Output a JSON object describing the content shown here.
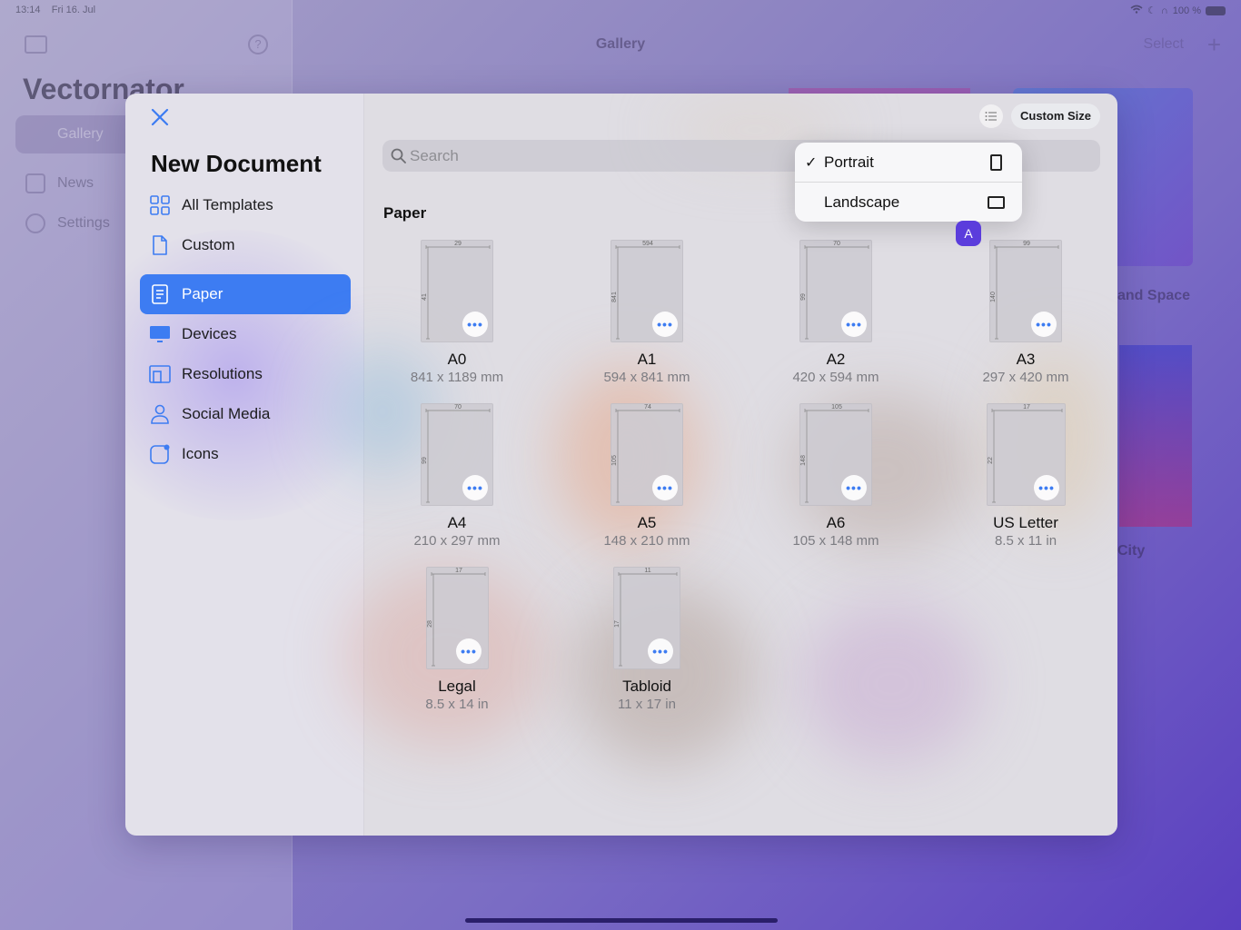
{
  "status_bar": {
    "time": "13:14",
    "date": "Fri 16. Jul",
    "battery": "100 %"
  },
  "background": {
    "nav_title": "Gallery",
    "select_label": "Select",
    "app_name": "Vectornator",
    "sidebar": [
      {
        "label": "Gallery"
      },
      {
        "label": "News"
      },
      {
        "label": "Settings"
      }
    ],
    "card_labels": [
      "and Space",
      "City"
    ]
  },
  "modal": {
    "title": "New Document",
    "sidebar": [
      {
        "label": "All Templates",
        "icon": "grid-icon"
      },
      {
        "label": "Custom",
        "icon": "document-icon"
      },
      {
        "label": "Paper",
        "icon": "paper-icon",
        "active": true
      },
      {
        "label": "Devices",
        "icon": "monitor-icon"
      },
      {
        "label": "Resolutions",
        "icon": "resolution-icon"
      },
      {
        "label": "Social Media",
        "icon": "person-icon"
      },
      {
        "label": "Icons",
        "icon": "app-icon"
      }
    ],
    "search_placeholder": "Search",
    "custom_size_label": "Custom Size",
    "section_title": "Paper",
    "templates": [
      {
        "name": "A0",
        "size": "841 x 1189 mm",
        "w_label": "29",
        "h_label": "41"
      },
      {
        "name": "A1",
        "size": "594 x 841 mm",
        "w_label": "594",
        "h_label": "841"
      },
      {
        "name": "A2",
        "size": "420 x 594 mm",
        "w_label": "70",
        "h_label": "99"
      },
      {
        "name": "A3",
        "size": "297 x 420 mm",
        "w_label": "99",
        "h_label": "140"
      },
      {
        "name": "A4",
        "size": "210 x 297 mm",
        "w_label": "70",
        "h_label": "99"
      },
      {
        "name": "A5",
        "size": "148 x 210 mm",
        "w_label": "74",
        "h_label": "105"
      },
      {
        "name": "A6",
        "size": "105 x 148 mm",
        "w_label": "105",
        "h_label": "148"
      },
      {
        "name": "US Letter",
        "size": "8.5 x 11 in",
        "w_label": "17",
        "h_label": "22"
      },
      {
        "name": "Legal",
        "size": "8.5 x 14 in",
        "w_label": "17",
        "h_label": "28"
      },
      {
        "name": "Tabloid",
        "size": "11 x 17 in",
        "w_label": "11",
        "h_label": "17"
      }
    ]
  },
  "orientation_menu": {
    "items": [
      {
        "label": "Portrait",
        "checked": true,
        "check_mark": "✓"
      },
      {
        "label": "Landscape",
        "checked": false,
        "check_mark": ""
      }
    ]
  },
  "avatar_letter": "A",
  "colors": {
    "accent": "#3d7cf2",
    "avatar": "#5b3ddc"
  }
}
